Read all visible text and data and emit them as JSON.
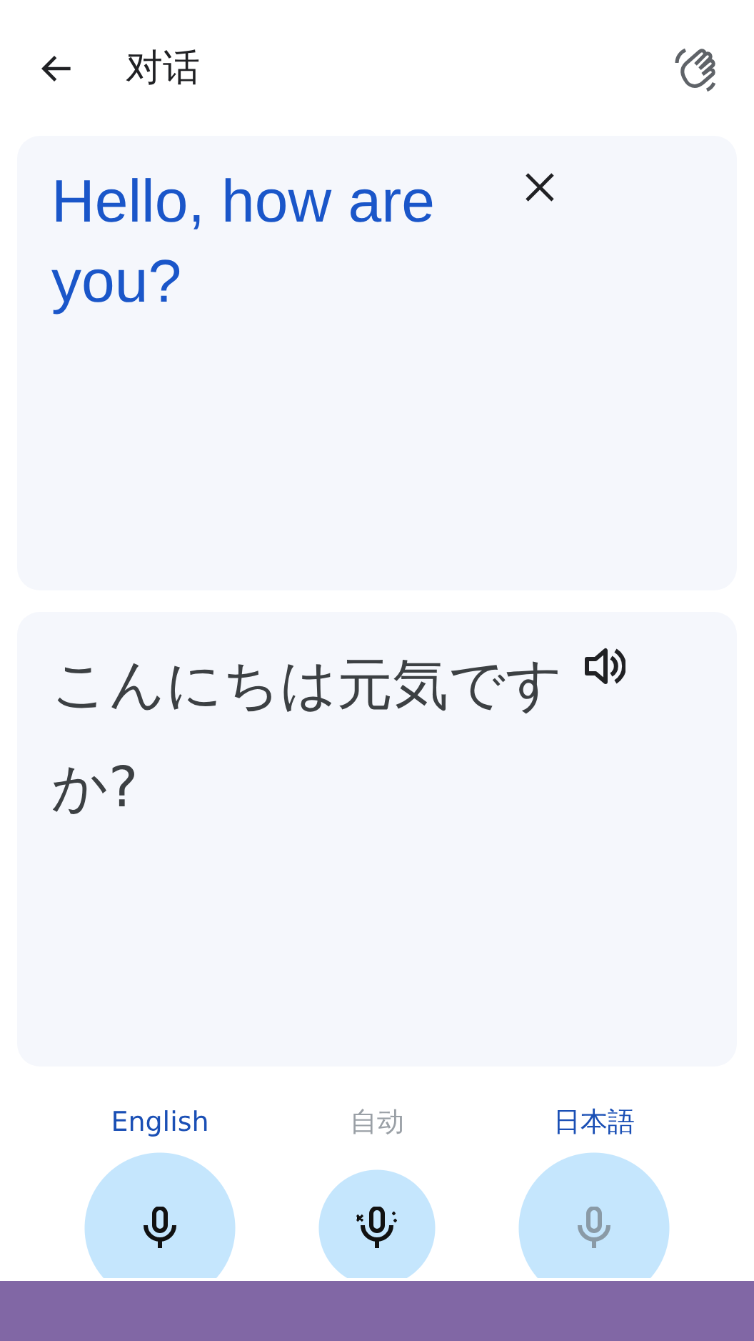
{
  "header": {
    "title": "对话"
  },
  "source": {
    "text": "Hello, how are you?"
  },
  "translation": {
    "text": "こんにちは元気ですか?"
  },
  "speakers": [
    {
      "kind": "language",
      "label": "English",
      "label_disabled": false,
      "mic_disabled": false
    },
    {
      "kind": "auto",
      "label": "自动",
      "label_disabled": true,
      "mic_disabled": false
    },
    {
      "kind": "language",
      "label": "日本語",
      "label_disabled": false,
      "mic_disabled": true
    }
  ]
}
